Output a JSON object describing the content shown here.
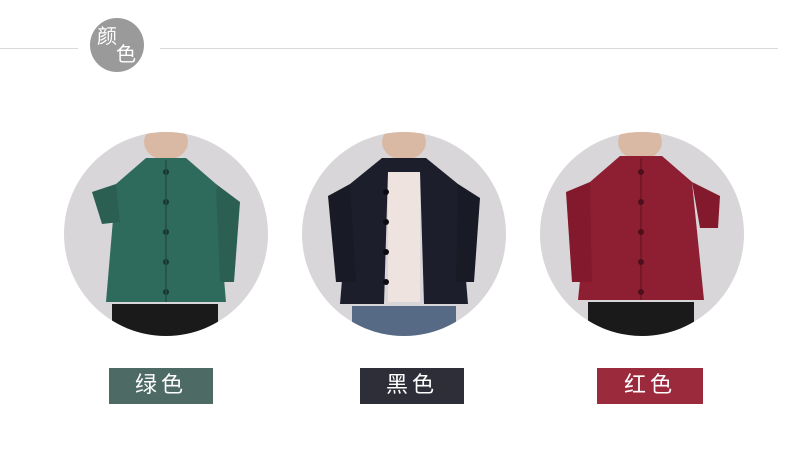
{
  "header": {
    "title_chars": [
      "颜",
      "色"
    ],
    "badge_color": "#9a9a9a"
  },
  "colors": [
    {
      "label": "绿色",
      "garment_color": "#2f6b5c",
      "label_bg": "#4d6a64",
      "icon": "green-jacket-photo"
    },
    {
      "label": "黑色",
      "garment_color": "#1c1f2b",
      "label_bg": "#2d2e38",
      "icon": "black-jacket-photo"
    },
    {
      "label": "红色",
      "garment_color": "#8e1f33",
      "label_bg": "#9b2a3d",
      "icon": "red-jacket-photo"
    }
  ]
}
